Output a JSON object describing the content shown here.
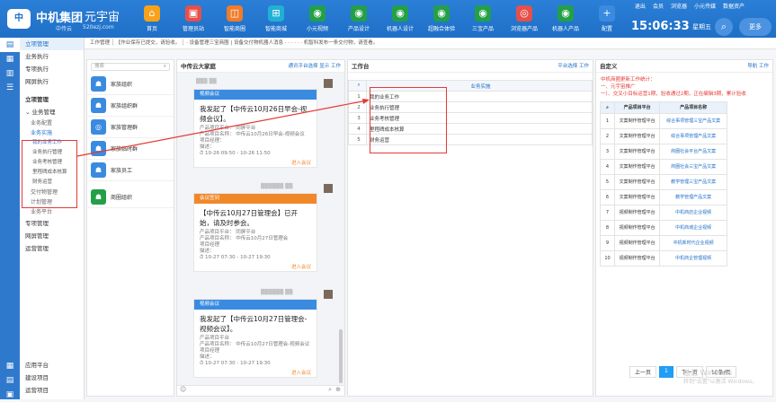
{
  "header": {
    "logo_text": "中",
    "brand": "中机集团",
    "brand_sub": "中传云",
    "brand2": "元宇宙",
    "brand2_sub": "520ezj.com",
    "nav": [
      {
        "label": "首页",
        "color": "#f7a21b",
        "icon": "home-icon",
        "glyph": "⌂"
      },
      {
        "label": "管理员站",
        "color": "#e6504a",
        "icon": "monitor-icon",
        "glyph": "▣"
      },
      {
        "label": "智能商圈",
        "color": "#f07b29",
        "icon": "store-icon",
        "glyph": "◫"
      },
      {
        "label": "智能商城",
        "color": "#21b0d6",
        "icon": "cart-icon",
        "glyph": "⊞"
      },
      {
        "label": "小元视频",
        "color": "#23a047",
        "icon": "video-icon",
        "glyph": "◉"
      },
      {
        "label": "产品设计",
        "color": "#23a047",
        "icon": "design-icon",
        "glyph": "◉"
      },
      {
        "label": "机器人设计",
        "color": "#23a047",
        "icon": "robot-icon",
        "glyph": "◉"
      },
      {
        "label": "超融合体验",
        "color": "#23a047",
        "icon": "experience-icon",
        "glyph": "◉"
      },
      {
        "label": "三宝产品",
        "color": "#23a047",
        "icon": "product-icon",
        "glyph": "◉"
      },
      {
        "label": "浏览器产品",
        "color": "#e6504a",
        "icon": "browser-icon",
        "glyph": "◎"
      },
      {
        "label": "机器人产品",
        "color": "#23a047",
        "icon": "robot-product-icon",
        "glyph": "◉"
      },
      {
        "label": "配置",
        "color": "#3a8be0",
        "icon": "plus-icon",
        "glyph": "+"
      }
    ],
    "top_links": [
      "退出",
      "会员",
      "浏览器",
      "小元传媒",
      "数据资产"
    ],
    "clock": "15:06:33",
    "weekday": "星期五",
    "more": "更多"
  },
  "left_icons": [
    {
      "icon": "chat-icon",
      "glyph": "▤"
    },
    {
      "icon": "task-icon",
      "glyph": "▦"
    },
    {
      "icon": "calendar-icon",
      "glyph": "▥"
    },
    {
      "icon": "people-icon",
      "glyph": "☰"
    }
  ],
  "left_icons_bottom": [
    {
      "icon": "app-icon",
      "glyph": "▦"
    },
    {
      "icon": "build-icon",
      "glyph": "▤"
    },
    {
      "icon": "ops-icon",
      "glyph": "▣"
    }
  ],
  "sidebar": {
    "top": [
      "立项管理",
      "业务执行",
      "专项执行",
      "网屏执行"
    ],
    "section": "立项管理",
    "group": "业务管理",
    "subs_before": [
      "业务配置"
    ],
    "sub_group": "业务实施",
    "sub_items": [
      "我的业务工作",
      "业务执行管理",
      "业务考核管理",
      "里程碑成本核算",
      "财务运营"
    ],
    "subs_after": [
      "交付物管理",
      "计划管理",
      "业务平台"
    ],
    "groups_after": [
      "专项管理",
      "网屏管理",
      "运营管理"
    ],
    "bottom": [
      "应用平台",
      "建设项目",
      "运营项目"
    ]
  },
  "notice": "工作管理 ┊ 【作业保存已提交，请验收。 ┊ · 设备管理三宝商圈 | 设备交付物机器人消息 · · · · · · 机智科发布一条交付物，请查看。",
  "contacts_panel": {
    "search_placeholder": "搜索",
    "items": [
      {
        "name": "家族组织",
        "color": "#3a8be0",
        "icon": "org-icon",
        "glyph": "☗"
      },
      {
        "name": "家族组织群",
        "color": "#3a8be0",
        "icon": "group-icon",
        "glyph": "☗"
      },
      {
        "name": "家族管理群",
        "color": "#3a8be0",
        "icon": "manage-group-icon",
        "glyph": "◎"
      },
      {
        "name": "家族临时群",
        "color": "#3a8be0",
        "icon": "temp-group-icon",
        "glyph": "☗"
      },
      {
        "name": "家族员工",
        "color": "#3a8be0",
        "icon": "staff-icon",
        "glyph": "☗"
      },
      {
        "name": "商圈组织",
        "color": "#23a047",
        "icon": "business-org-icon",
        "glyph": "☗"
      }
    ]
  },
  "chat": {
    "title": "中传云大家庭",
    "actions": [
      "通讯平台选择",
      "显示",
      "工作"
    ],
    "cards": [
      {
        "header": "视频会议",
        "header_color": "#3a8be0",
        "title": "我发起了【中传云10月26日早会-视频会议】。",
        "lines": [
          "产品项目平台：  同屏平台",
          "产品项目名称：  中传云10月26日早会-视频会议",
          "项目经理：",
          "描述：",
          "⏱ 10-26 09:50 - 10-26 11:50"
        ],
        "go": "进入会议"
      },
      {
        "header": "会议签到",
        "header_color": "#f0882a",
        "title": "【中传云10月27日管理会】已开始，请及时参会。",
        "lines": [
          "产品项目平台：  同屏平台",
          "产品项目名称：  中传云10月27日管理会",
          "项目经理",
          "描述：",
          "⏱ 10-27 07:30 - 10-27 19:30"
        ],
        "go": "进入会议"
      },
      {
        "header": "视频会议",
        "header_color": "#3a8be0",
        "title": "我发起了【中传云10月27日管理会-视频会议】。",
        "lines": [
          "产品项目平台",
          "产品项目名称：  中传云10月27日管理会-视频会议",
          "项目经理",
          "描述：",
          "⏱ 10-27 07:30 - 10-27 19:30"
        ],
        "go": "进入会议"
      }
    ]
  },
  "workbench": {
    "title": "工作台",
    "actions": [
      "平台选择",
      "工作"
    ],
    "table_header": "业务实施",
    "rows": [
      {
        "num": "1",
        "text": "我的业务工作"
      },
      {
        "num": "2",
        "text": "业务执行管理"
      },
      {
        "num": "3",
        "text": "业务考核管理"
      },
      {
        "num": "4",
        "text": "里程碑成本核算"
      },
      {
        "num": "5",
        "text": "财务运营"
      }
    ]
  },
  "right_panel": {
    "title": "自定义",
    "actions": [
      "导航",
      "工作"
    ],
    "intro": [
      "中机商圈更新工作统计：",
      "一、元宇宙推广",
      "一）、交叉小目标运营1期，验收通过2期，正在编辑3期，累计验收"
    ],
    "col_headers": [
      "产品项目平台",
      "产品项目名称"
    ],
    "rows": [
      {
        "num": "1",
        "platform": "文案制作管理平台",
        "name": "综合事项管理三宝产品文案"
      },
      {
        "num": "2",
        "platform": "文案制作管理平台",
        "name": "综合事项管理产品文案"
      },
      {
        "num": "3",
        "platform": "文案制作管理平台",
        "name": "商圈社会平台产品文案"
      },
      {
        "num": "4",
        "platform": "文案制作管理平台",
        "name": "商圈社会三宝产品文案"
      },
      {
        "num": "5",
        "platform": "文案制作管理平台",
        "name": "教学管理三宝产品文案"
      },
      {
        "num": "6",
        "platform": "文案制作管理平台",
        "name": "教学管理产品文案"
      },
      {
        "num": "7",
        "platform": "视频制作管理平台",
        "name": "中机商店企业视频"
      },
      {
        "num": "8",
        "platform": "视频制作管理平台",
        "name": "中机商城企业视频"
      },
      {
        "num": "9",
        "platform": "视频制作管理平台",
        "name": "中机新时代企业视频"
      },
      {
        "num": "10",
        "platform": "视频制作管理平台",
        "name": "中机商企管理视频"
      }
    ],
    "pager": [
      "上一页",
      "1",
      "下一页",
      "10条/页"
    ],
    "watermark1": "激活 Windows",
    "watermark2": "转到\"设置\"以激活 Windows。"
  }
}
